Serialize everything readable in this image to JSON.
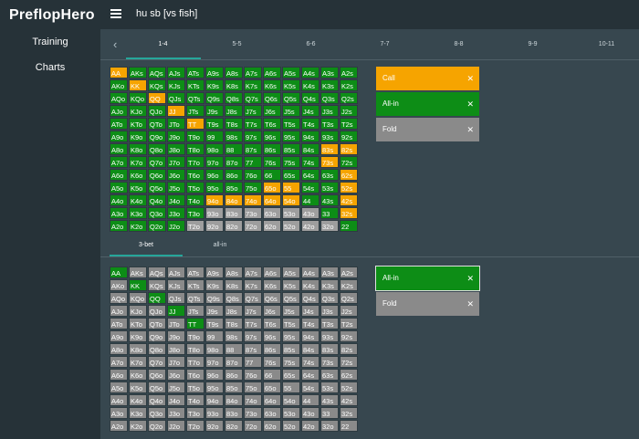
{
  "app": {
    "title": "PreflopHero"
  },
  "sidebar": {
    "items": [
      {
        "label": "Training"
      },
      {
        "label": "Charts"
      }
    ]
  },
  "header": {
    "scenario": "hu sb [vs fish]"
  },
  "stack_tabs": [
    {
      "label": "1-4"
    },
    {
      "label": "5-5"
    },
    {
      "label": "6-6"
    },
    {
      "label": "7-7"
    },
    {
      "label": "8-8"
    },
    {
      "label": "9-9"
    },
    {
      "label": "10-11"
    }
  ],
  "mid_tabs": [
    {
      "label": "3-bet"
    },
    {
      "label": "all-in"
    }
  ],
  "hands": [
    [
      "AA",
      "AKs",
      "AQs",
      "AJs",
      "ATs",
      "A9s",
      "A8s",
      "A7s",
      "A6s",
      "A5s",
      "A4s",
      "A3s",
      "A2s"
    ],
    [
      "AKo",
      "KK",
      "KQs",
      "KJs",
      "KTs",
      "K9s",
      "K8s",
      "K7s",
      "K6s",
      "K5s",
      "K4s",
      "K3s",
      "K2s"
    ],
    [
      "AQo",
      "KQo",
      "QQ",
      "QJs",
      "QTs",
      "Q9s",
      "Q8s",
      "Q7s",
      "Q6s",
      "Q5s",
      "Q4s",
      "Q3s",
      "Q2s"
    ],
    [
      "AJo",
      "KJo",
      "QJo",
      "JJ",
      "JTs",
      "J9s",
      "J8s",
      "J7s",
      "J6s",
      "J5s",
      "J4s",
      "J3s",
      "J2s"
    ],
    [
      "ATo",
      "KTo",
      "QTo",
      "JTo",
      "TT",
      "T9s",
      "T8s",
      "T7s",
      "T6s",
      "T5s",
      "T4s",
      "T3s",
      "T2s"
    ],
    [
      "A9o",
      "K9o",
      "Q9o",
      "J9o",
      "T9o",
      "99",
      "98s",
      "97s",
      "96s",
      "95s",
      "94s",
      "93s",
      "92s"
    ],
    [
      "A8o",
      "K8o",
      "Q8o",
      "J8o",
      "T8o",
      "98o",
      "88",
      "87s",
      "86s",
      "85s",
      "84s",
      "83s",
      "82s"
    ],
    [
      "A7o",
      "K7o",
      "Q7o",
      "J7o",
      "T7o",
      "97o",
      "87o",
      "77",
      "76s",
      "75s",
      "74s",
      "73s",
      "72s"
    ],
    [
      "A6o",
      "K6o",
      "Q6o",
      "J6o",
      "T6o",
      "96o",
      "86o",
      "76o",
      "66",
      "65s",
      "64s",
      "63s",
      "62s"
    ],
    [
      "A5o",
      "K5o",
      "Q5o",
      "J5o",
      "T5o",
      "95o",
      "85o",
      "75o",
      "65o",
      "55",
      "54s",
      "53s",
      "52s"
    ],
    [
      "A4o",
      "K4o",
      "Q4o",
      "J4o",
      "T4o",
      "94o",
      "84o",
      "74o",
      "64o",
      "54o",
      "44",
      "43s",
      "42s"
    ],
    [
      "A3o",
      "K3o",
      "Q3o",
      "J3o",
      "T3o",
      "93o",
      "83o",
      "73o",
      "63o",
      "53o",
      "43o",
      "33",
      "32s"
    ],
    [
      "A2o",
      "K2o",
      "Q2o",
      "J2o",
      "T2o",
      "92o",
      "82o",
      "72o",
      "62o",
      "52o",
      "42o",
      "32o",
      "22"
    ]
  ],
  "top_chart": {
    "actions": [
      {
        "label": "Call",
        "color": "#f6a400",
        "kind": "call"
      },
      {
        "label": "All-in",
        "color": "#0d8d16",
        "kind": "allin"
      },
      {
        "label": "Fold",
        "color": "#8a8a8a",
        "kind": "fold"
      }
    ],
    "colors": [
      "ogggggggggggg",
      "gogggggggggggg",
      "ggoggggggggggg",
      "gggoggggggggg",
      "ggggogggggggg",
      "ggggggggggggg",
      "gggggggggggoo",
      "gggggggggggog",
      "gggggggggggggo",
      "ggggggggooggo",
      "gggggoooooggo",
      "gggggyyyyyygoz",
      "ggggyyyyyyyyg"
    ]
  },
  "bottom_chart": {
    "actions": [
      {
        "label": "All-in",
        "color": "#0d8d16",
        "kind": "allin",
        "selected": true
      },
      {
        "label": "Fold",
        "color": "#8a8a8a",
        "kind": "fold"
      }
    ],
    "colors": [
      "gkkkkkkkkkkkk",
      "kgkkkkkkkkkkk",
      "kkgkkkkkkkkkk",
      "kkkgkkkkkkkkk",
      "kkkkgkkkkkkkk",
      "kkkkkkkkkkkkk",
      "kkkkkkkkkkkkk",
      "kkkkkkkkkkkkk",
      "kkkkkkkkkkkkk",
      "kkkkkkkkkkkkk",
      "kkkkkkkkkkkkk",
      "kkkkkkkkkkkkk",
      "kkkkkkkkkkkkk"
    ]
  }
}
